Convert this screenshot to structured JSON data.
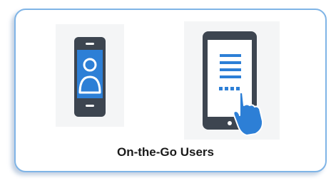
{
  "card": {
    "caption": "On-the-Go Users"
  },
  "icons": {
    "phone": "smartphone-user-icon",
    "tablet": "tablet-touch-icon"
  },
  "colors": {
    "border": "#7fb4e6",
    "device_body": "#3d4550",
    "screen_blue": "#2d7fd6",
    "hand_blue": "#2d7fd6"
  }
}
